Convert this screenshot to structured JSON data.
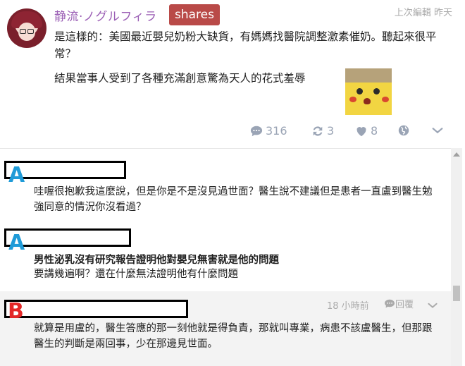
{
  "post": {
    "author": "静流·ノグルフィラ",
    "badge": "shares",
    "edited": "上次編輯 昨天",
    "paragraph1": "是這樣的：美國最近嬰兒奶粉大缺貨，有媽媽找醫院調整激素催奶。聽起來很平常？",
    "paragraph2": "結果當事人受到了各種充滿創意驚為天人的花式羞辱",
    "actions": {
      "comments": "316",
      "shares": "3",
      "likes": "8"
    },
    "icons": [
      "comment-icon",
      "share-icon",
      "heart-icon",
      "globe-icon",
      "chevron-down-icon"
    ]
  },
  "comments": [
    {
      "tag": "A",
      "text": "哇喔很抱歉我這麼說，但是你是不是沒見過世面？醫生說不建議但是患者一直盧到醫生勉強同意的情況你沒看過？"
    },
    {
      "tag": "A",
      "quote": "男性泌乳沒有研究報告證明他對嬰兒無害就是他的問題",
      "text": "要講幾遍啊？還在什麼無法證明他有什麼問題"
    },
    {
      "tag": "B",
      "time": "18 小時前",
      "reply": "回覆",
      "text": "就算是用盧的，醫生答應的那一刻他就是得負責，那就叫專業，病患不該盧醫生，但那跟醫生的判斷是兩回事，少在那邊見世面。"
    }
  ],
  "colors": {
    "author": "#9b5fb5",
    "badge": "#b94a48",
    "tagA": "#1f9bd8",
    "tagB": "#e32727",
    "icon": "#9aa4b5"
  }
}
